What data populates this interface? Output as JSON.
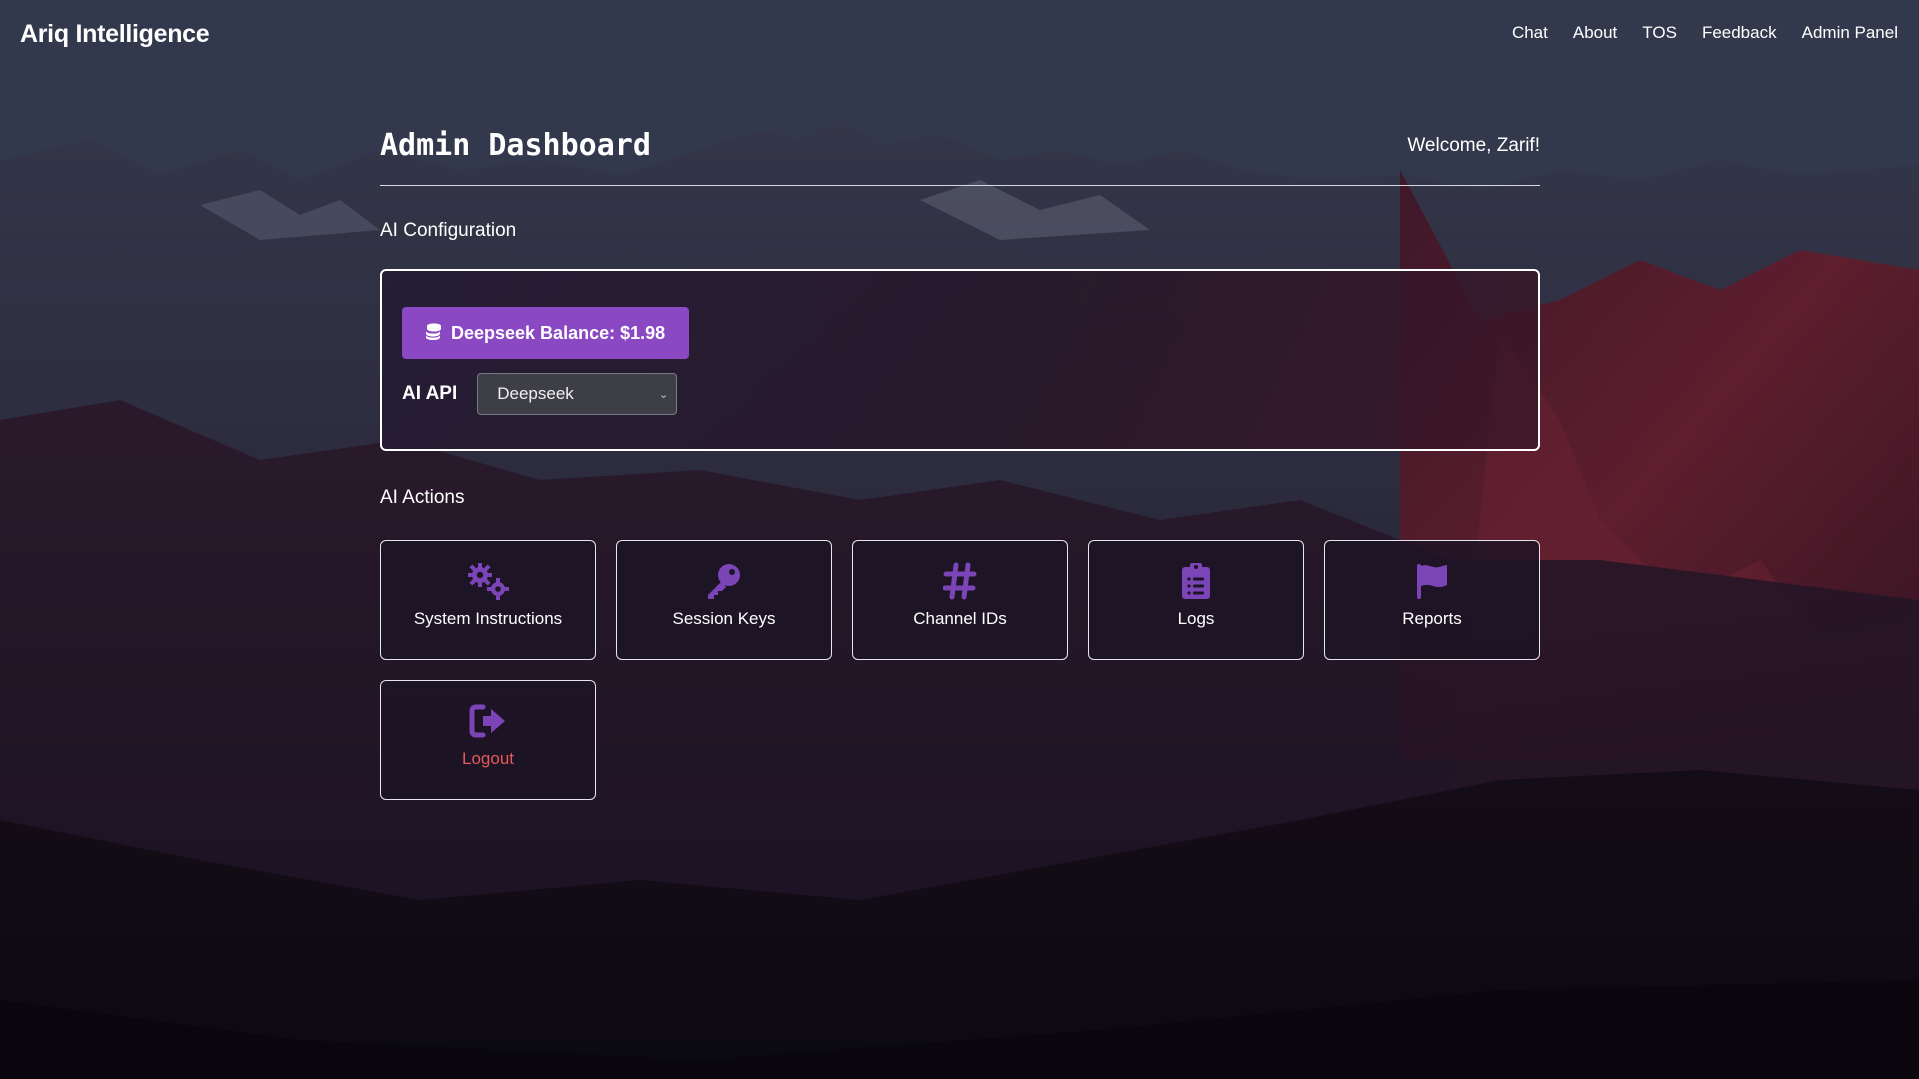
{
  "navbar": {
    "brand": "Ariq Intelligence",
    "links": [
      "Chat",
      "About",
      "TOS",
      "Feedback",
      "Admin Panel"
    ]
  },
  "header": {
    "title": "Admin Dashboard",
    "welcome": "Welcome, Zarif!"
  },
  "config": {
    "section_title": "AI Configuration",
    "balance_label": "Deepseek Balance: $1.98",
    "api_label": "AI API",
    "api_selected": "Deepseek"
  },
  "actions": {
    "section_title": "AI Actions",
    "items": [
      {
        "label": "System Instructions",
        "icon": "gears-icon"
      },
      {
        "label": "Session Keys",
        "icon": "key-icon"
      },
      {
        "label": "Channel IDs",
        "icon": "hashtag-icon"
      },
      {
        "label": "Logs",
        "icon": "clipboard-icon"
      },
      {
        "label": "Reports",
        "icon": "flag-icon"
      },
      {
        "label": "Logout",
        "icon": "logout-icon"
      }
    ]
  },
  "colors": {
    "accent_purple": "#8a48c2",
    "icon_purple": "#7b45b8",
    "logout_red": "#e25a5a"
  }
}
